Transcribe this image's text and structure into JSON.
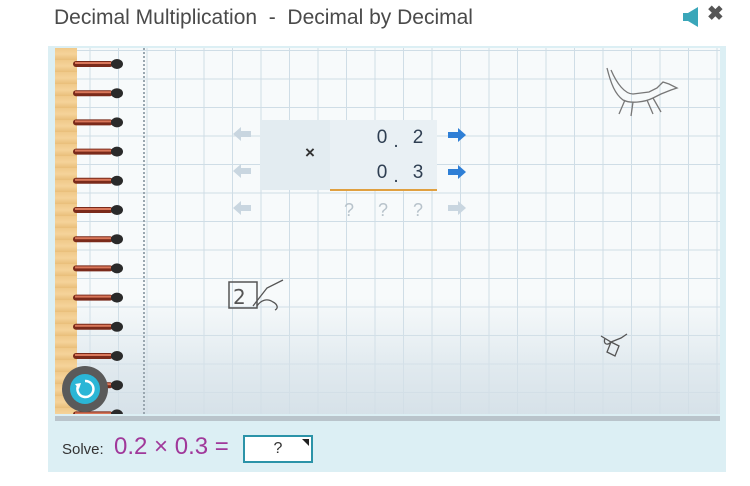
{
  "header": {
    "title": "Decimal Multiplication  -  Decimal by Decimal",
    "speaker_icon": "speaker-icon",
    "close_label": "✖"
  },
  "problem": {
    "operator": "×",
    "row1": [
      "0",
      ".",
      "2"
    ],
    "row2": [
      "0",
      ".",
      "3"
    ],
    "answer_row": [
      "?",
      "?",
      "?"
    ]
  },
  "solve": {
    "label": "Solve:",
    "expression": "0.2 × 0.3 =",
    "answer_placeholder": "?"
  },
  "colors": {
    "title": "#4a4a4a",
    "expression": "#a0389a",
    "arrow_active": "#2f7fd6",
    "arrow_inactive": "#c9d6e0",
    "underline": "#e0a040",
    "answer_border": "#2b93a8"
  },
  "icons": {
    "reset": "reset-icon",
    "arrow": "arrow-right-icon",
    "fox": "fox-doodle-icon",
    "bug": "bug-doodle-icon",
    "number_card": "number-card-doodle-icon"
  }
}
